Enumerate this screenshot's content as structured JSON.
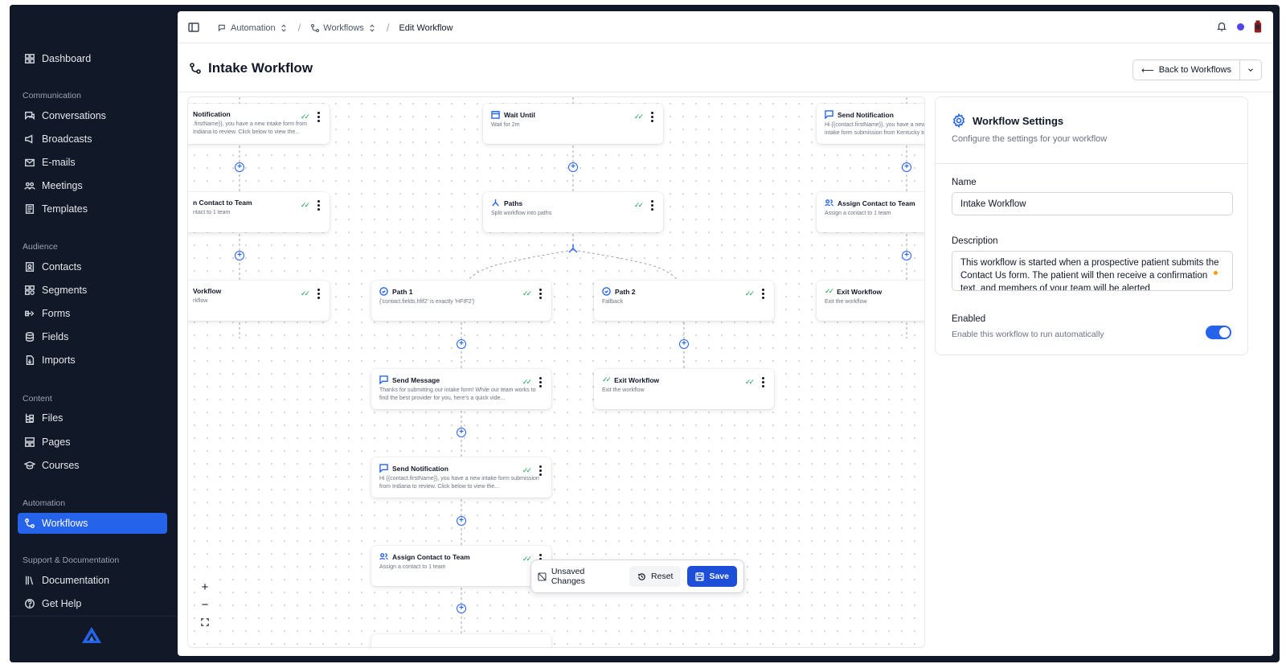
{
  "sidebar": {
    "dashboard": "Dashboard",
    "sections": {
      "communication": "Communication",
      "audience": "Audience",
      "content": "Content",
      "automation": "Automation",
      "support": "Support & Documentation"
    },
    "items": {
      "conversations": "Conversations",
      "broadcasts": "Broadcasts",
      "emails": "E-mails",
      "meetings": "Meetings",
      "templates": "Templates",
      "contacts": "Contacts",
      "segments": "Segments",
      "forms": "Forms",
      "fields": "Fields",
      "imports": "Imports",
      "files": "Files",
      "pages": "Pages",
      "courses": "Courses",
      "workflows": "Workflows",
      "documentation": "Documentation",
      "help": "Get Help"
    }
  },
  "breadcrumb": {
    "automation": "Automation",
    "workflows": "Workflows",
    "current": "Edit Workflow"
  },
  "page": {
    "title": "Intake Workflow",
    "back_label": "Back to Workflows"
  },
  "nodes": {
    "l_notif_title": "Notification",
    "l_notif_sub": ".firstName}}, you have a new intake form from Indiana to review. Click below to view the...",
    "l_assign_title": "n Contact to Team",
    "l_assign_sub": "ntact to 1 team",
    "l_exit_title": "Vorkflow",
    "l_exit_sub": "rkflow",
    "wait_title": "Wait Until",
    "wait_sub": "Wait for 2m",
    "paths_title": "Paths",
    "paths_sub": "Split workflow into paths",
    "path1_title": "Path 1",
    "path1_sub": "{'contact.fields.hfif2' is exactly 'HFIF2'}",
    "path2_title": "Path 2",
    "path2_sub": "Fallback",
    "msg_title": "Send Message",
    "msg_sub": "Thanks for submitting our intake form! While our team works to find the best provider for you, here's a quick vide...",
    "exit2_title": "Exit Workflow",
    "exit2_sub": "Exit the workflow",
    "notif2_title": "Send Notification",
    "notif2_sub": "Hi {{contact.firstName}}, you have a new intake form submission from Indiana to review. Click below to view the...",
    "assign2_title": "Assign Contact to Team",
    "assign2_sub": "Assign a contact to 1 team",
    "r_notif_title": "Send Notification",
    "r_notif_sub": "Hi {{contact.firstName}}, you have a new intake form submission from Kentucky to review.",
    "r_assign_title": "Assign Contact to Team",
    "r_assign_sub": "Assign a contact to 1 team",
    "r_exit_title": "Exit Workflow",
    "r_exit_sub": "Exit the workflow"
  },
  "unsaved": {
    "label": "Unsaved Changes",
    "reset": "Reset",
    "save": "Save"
  },
  "settings": {
    "title": "Workflow Settings",
    "subtitle": "Configure the settings for your workflow",
    "name_label": "Name",
    "name_value": "Intake Workflow",
    "desc_label": "Description",
    "desc_value": "This workflow is started when a prospective patient submits the Contact Us form. The patient will then receive a confirmation text, and members of your team will be alerted",
    "enabled_label": "Enabled",
    "enabled_help": "Enable this workflow to run automatically",
    "enabled": true
  },
  "colors": {
    "accent": "#2563eb",
    "sidebar_bg": "#111827",
    "check": "#16a34a"
  }
}
